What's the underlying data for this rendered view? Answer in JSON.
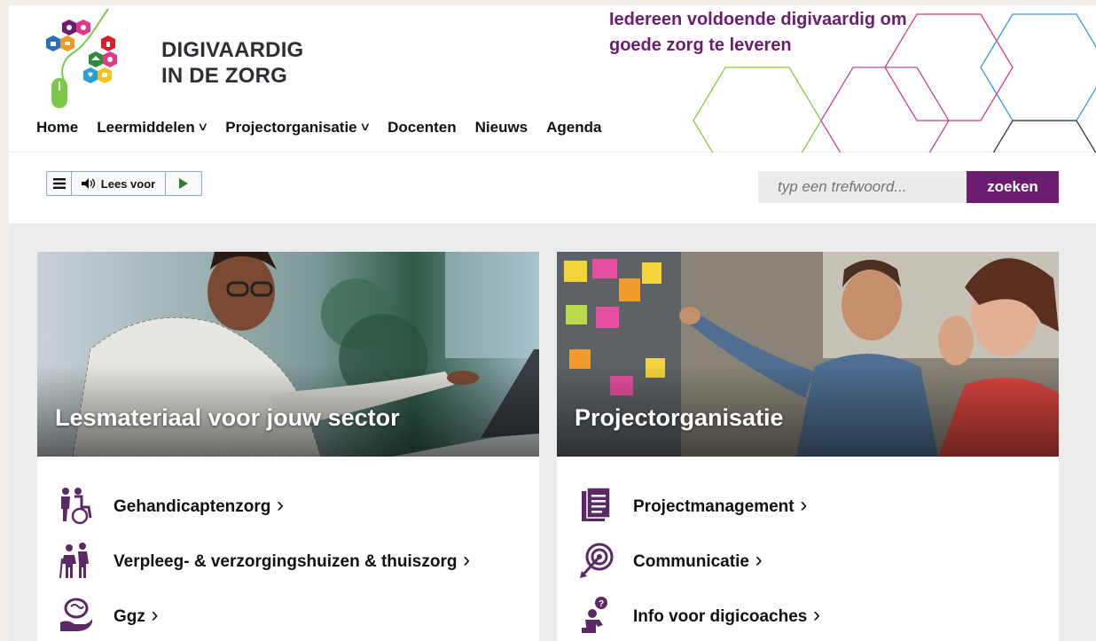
{
  "logo": {
    "line1": "DIGIVAARDIG",
    "line2": "IN DE ZORG"
  },
  "tagline": {
    "line1": "Iedereen voldoende digivaardig om",
    "line2": "goede zorg te leveren"
  },
  "nav": {
    "items": [
      {
        "label": "Home",
        "dropdown": false
      },
      {
        "label": "Leermiddelen",
        "dropdown": true
      },
      {
        "label": "Projectorganisatie",
        "dropdown": true
      },
      {
        "label": "Docenten",
        "dropdown": false
      },
      {
        "label": "Nieuws",
        "dropdown": false
      },
      {
        "label": "Agenda",
        "dropdown": false
      }
    ]
  },
  "readbar": {
    "label": "Lees voor"
  },
  "search": {
    "placeholder": "typ een trefwoord...",
    "button_label": "zoeken"
  },
  "cards": [
    {
      "title": "Lesmateriaal voor jouw sector",
      "links": [
        {
          "label": "Gehandicaptenzorg",
          "icon": "wheelchair-people-icon"
        },
        {
          "label": "Verpleeg- & verzorgingshuizen & thuiszorg",
          "icon": "elderly-care-icon"
        },
        {
          "label": "Ggz",
          "icon": "brain-hand-icon"
        }
      ]
    },
    {
      "title": "Projectorganisatie",
      "links": [
        {
          "label": "Projectmanagement",
          "icon": "document-stack-icon"
        },
        {
          "label": "Communicatie",
          "icon": "target-arrow-icon"
        },
        {
          "label": "Info voor digicoaches",
          "icon": "person-question-icon"
        }
      ]
    }
  ],
  "colors": {
    "brand": "#6b1e70",
    "icon": "#5b2a66"
  }
}
